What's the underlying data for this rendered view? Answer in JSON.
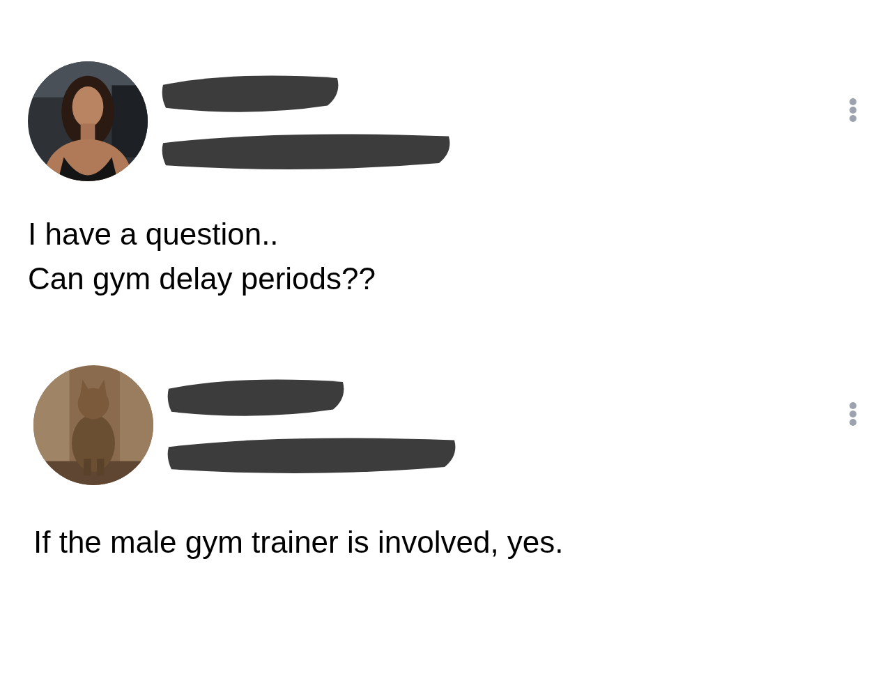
{
  "posts": [
    {
      "avatar": {
        "kind": "portrait"
      },
      "text_lines": [
        "I have a question..",
        "Can gym delay periods??"
      ]
    },
    {
      "avatar": {
        "kind": "animal"
      },
      "text_lines": [
        "If the male gym trainer is involved, yes."
      ]
    }
  ]
}
